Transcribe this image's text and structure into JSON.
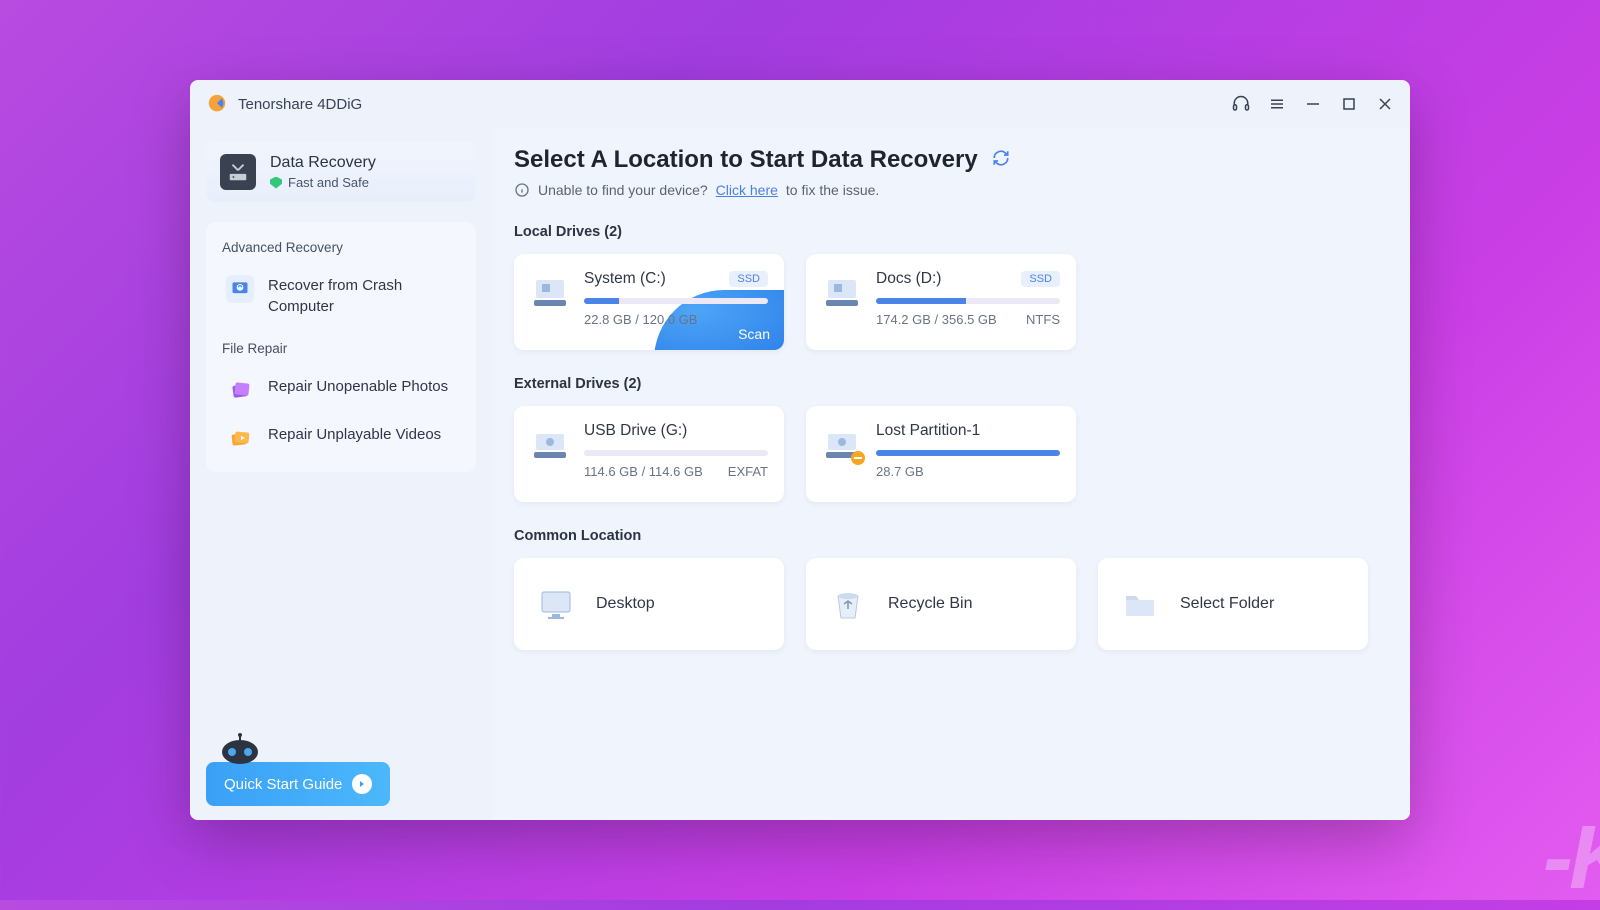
{
  "app": {
    "title": "Tenorshare 4DDiG"
  },
  "sidebar": {
    "primary": {
      "title": "Data Recovery",
      "subtitle": "Fast and Safe"
    },
    "advanced": {
      "label": "Advanced Recovery",
      "item": "Recover from Crash Computer"
    },
    "repair": {
      "label": "File Repair",
      "photos": "Repair Unopenable Photos",
      "videos": "Repair Unplayable Videos"
    },
    "guide": "Quick Start Guide"
  },
  "main": {
    "title": "Select A Location to Start Data Recovery",
    "hint_pre": "Unable to find your device?",
    "hint_link": "Click here",
    "hint_post": "to fix the issue.",
    "local": {
      "label": "Local Drives (2)",
      "d0": {
        "name": "System (C:)",
        "tag": "SSD",
        "usage": "22.8 GB / 120.0 GB",
        "scan": "Scan"
      },
      "d1": {
        "name": "Docs (D:)",
        "tag": "SSD",
        "usage": "174.2 GB / 356.5 GB",
        "fs": "NTFS"
      }
    },
    "external": {
      "label": "External Drives (2)",
      "d0": {
        "name": "USB Drive (G:)",
        "usage": "114.6 GB / 114.6 GB",
        "fs": "EXFAT"
      },
      "d1": {
        "name": "Lost Partition-1",
        "usage": "28.7 GB"
      }
    },
    "common": {
      "label": "Common Location",
      "desktop": "Desktop",
      "recycle": "Recycle Bin",
      "folder": "Select Folder"
    }
  }
}
